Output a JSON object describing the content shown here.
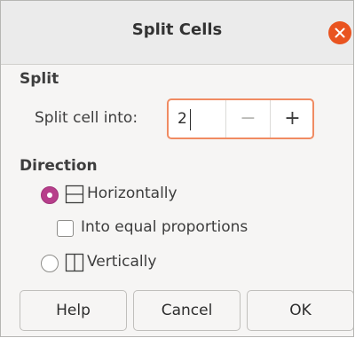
{
  "dialog": {
    "title": "Split Cells"
  },
  "split_section": {
    "heading": "Split",
    "split_into_label": "Split cell into:",
    "split_into_value": "2",
    "decrement_symbol": "−",
    "increment_symbol": "+"
  },
  "direction_section": {
    "heading": "Direction",
    "options": [
      {
        "label": "Horizontally",
        "selected": true,
        "icon": "split-horizontal-icon"
      },
      {
        "label": "Vertically",
        "selected": false,
        "icon": "split-vertical-icon"
      }
    ],
    "equal_proportions_label": "Into equal proportions",
    "equal_proportions_checked": false
  },
  "buttons": {
    "help": "Help",
    "cancel": "Cancel",
    "ok": "OK"
  },
  "colors": {
    "close_button": "#e95420",
    "radio_selected": "#b73e8b",
    "focus_border": "#f08b62"
  }
}
